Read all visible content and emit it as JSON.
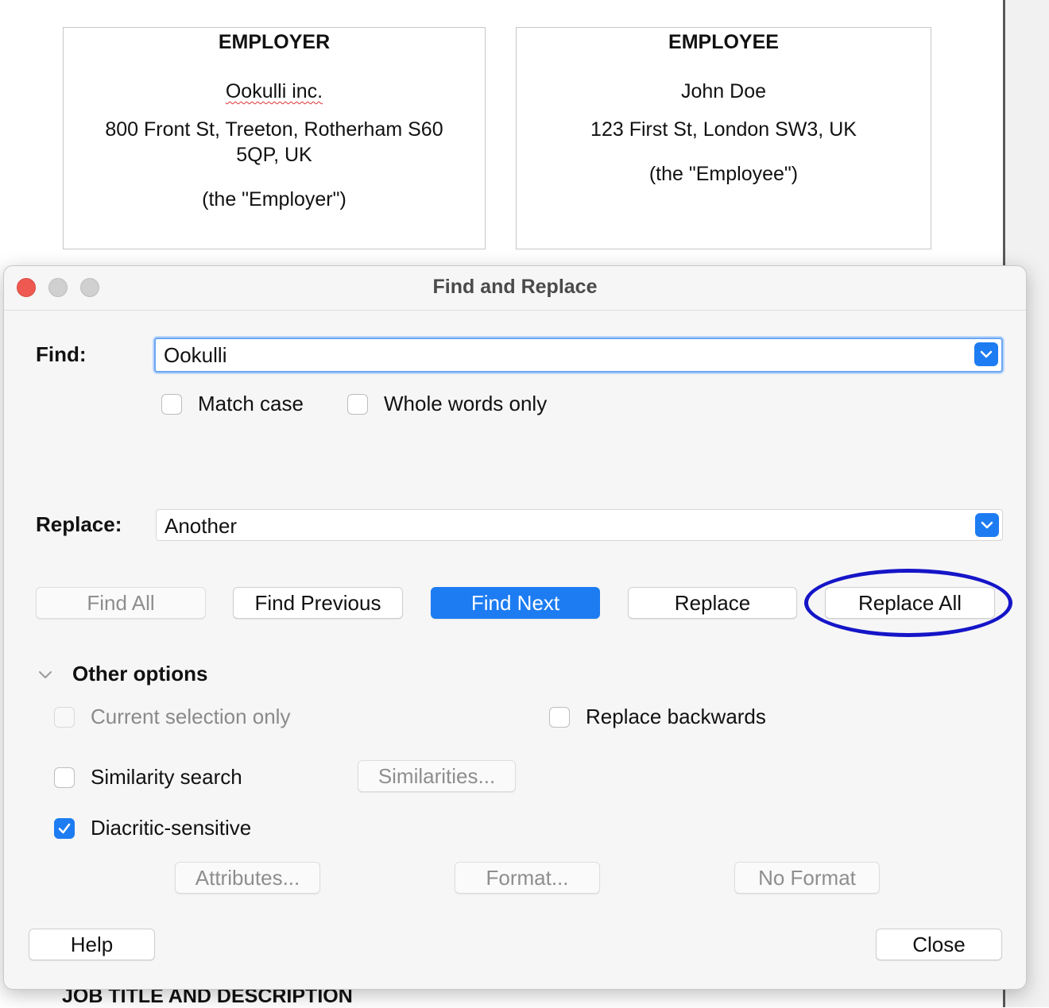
{
  "document": {
    "employer": {
      "heading": "EMPLOYER",
      "name": "Ookulli inc.",
      "address_line1": "800 Front St, Treeton, Rotherham S60",
      "address_line2": "5QP, UK",
      "designation": "(the \"Employer\")"
    },
    "employee": {
      "heading": "EMPLOYEE",
      "name": "John Doe",
      "address": "123 First St, London SW3, UK",
      "designation": "(the \"Employee\")"
    },
    "next_section_heading": "JOB TITLE AND DESCRIPTION"
  },
  "dialog": {
    "title": "Find and Replace",
    "find": {
      "label": "Find:",
      "value": "Ookulli"
    },
    "match_case": {
      "label": "Match case",
      "checked": false
    },
    "whole_words": {
      "label": "Whole words only",
      "checked": false
    },
    "replace": {
      "label": "Replace:",
      "value": "Another"
    },
    "buttons": {
      "find_all": "Find All",
      "find_previous": "Find Previous",
      "find_next": "Find Next",
      "replace": "Replace",
      "replace_all": "Replace All"
    },
    "other_options": {
      "label": "Other options",
      "current_selection_only": {
        "label": "Current selection only",
        "checked": false,
        "enabled": false
      },
      "replace_backwards": {
        "label": "Replace backwards",
        "checked": false
      },
      "similarity_search": {
        "label": "Similarity search",
        "checked": false
      },
      "similarities_button": "Similarities...",
      "diacritic_sensitive": {
        "label": "Diacritic-sensitive",
        "checked": true
      },
      "attributes_button": "Attributes...",
      "format_button": "Format...",
      "no_format_button": "No Format"
    },
    "help_button": "Help",
    "close_button": "Close"
  },
  "colors": {
    "accent": "#1d7cf2",
    "annotation": "#1515c8",
    "close_traffic_light": "#ee5a52"
  }
}
